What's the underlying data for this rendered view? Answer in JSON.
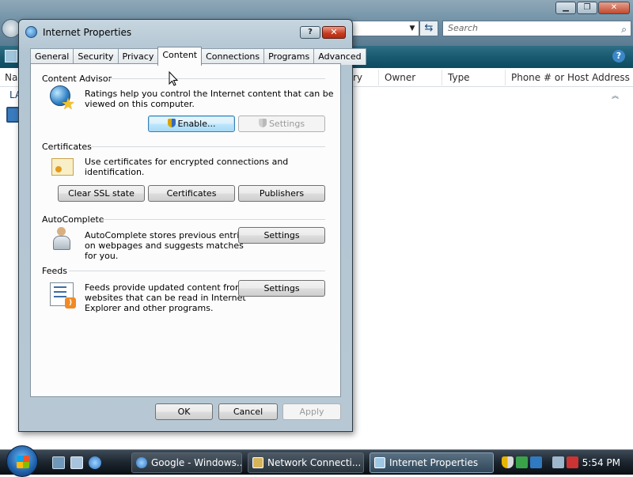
{
  "background_window": {
    "search_placeholder": "Search",
    "columns": [
      "Na",
      "ry",
      "Owner",
      "Type",
      "Phone # or Host Address"
    ],
    "group_label": "LA"
  },
  "dialog": {
    "title": "Internet Properties",
    "help_glyph": "?",
    "close_glyph": "✕",
    "tabs": [
      "General",
      "Security",
      "Privacy",
      "Content",
      "Connections",
      "Programs",
      "Advanced"
    ],
    "active_tab": "Content",
    "content_advisor": {
      "title": "Content Advisor",
      "description_line1": "Ratings help you control the Internet content that can be",
      "description_line2": "viewed on this computer.",
      "enable_label": "Enable...",
      "settings_label": "Settings"
    },
    "certificates": {
      "title": "Certificates",
      "description": "Use certificates for encrypted connections and identification.",
      "clear_ssl_label": "Clear SSL state",
      "certificates_label": "Certificates",
      "publishers_label": "Publishers"
    },
    "autocomplete": {
      "title": "AutoComplete",
      "description_line1": "AutoComplete stores previous entries",
      "description_line2": "on webpages and suggests matches",
      "description_line3": "for you.",
      "settings_label": "Settings"
    },
    "feeds": {
      "title": "Feeds",
      "description_line1": "Feeds provide updated content from",
      "description_line2": "websites that can be read in Internet",
      "description_line3": "Explorer and other programs.",
      "settings_label": "Settings"
    },
    "ok_label": "OK",
    "cancel_label": "Cancel",
    "apply_label": "Apply"
  },
  "taskbar": {
    "buttons": [
      "Google - Windows...",
      "Network Connecti...",
      "Internet Properties"
    ],
    "clock": "5:54 PM"
  },
  "colors": {
    "accent": "#1a5a70",
    "close_red": "#c5391e",
    "focus_blue": "#3c7fb1"
  }
}
